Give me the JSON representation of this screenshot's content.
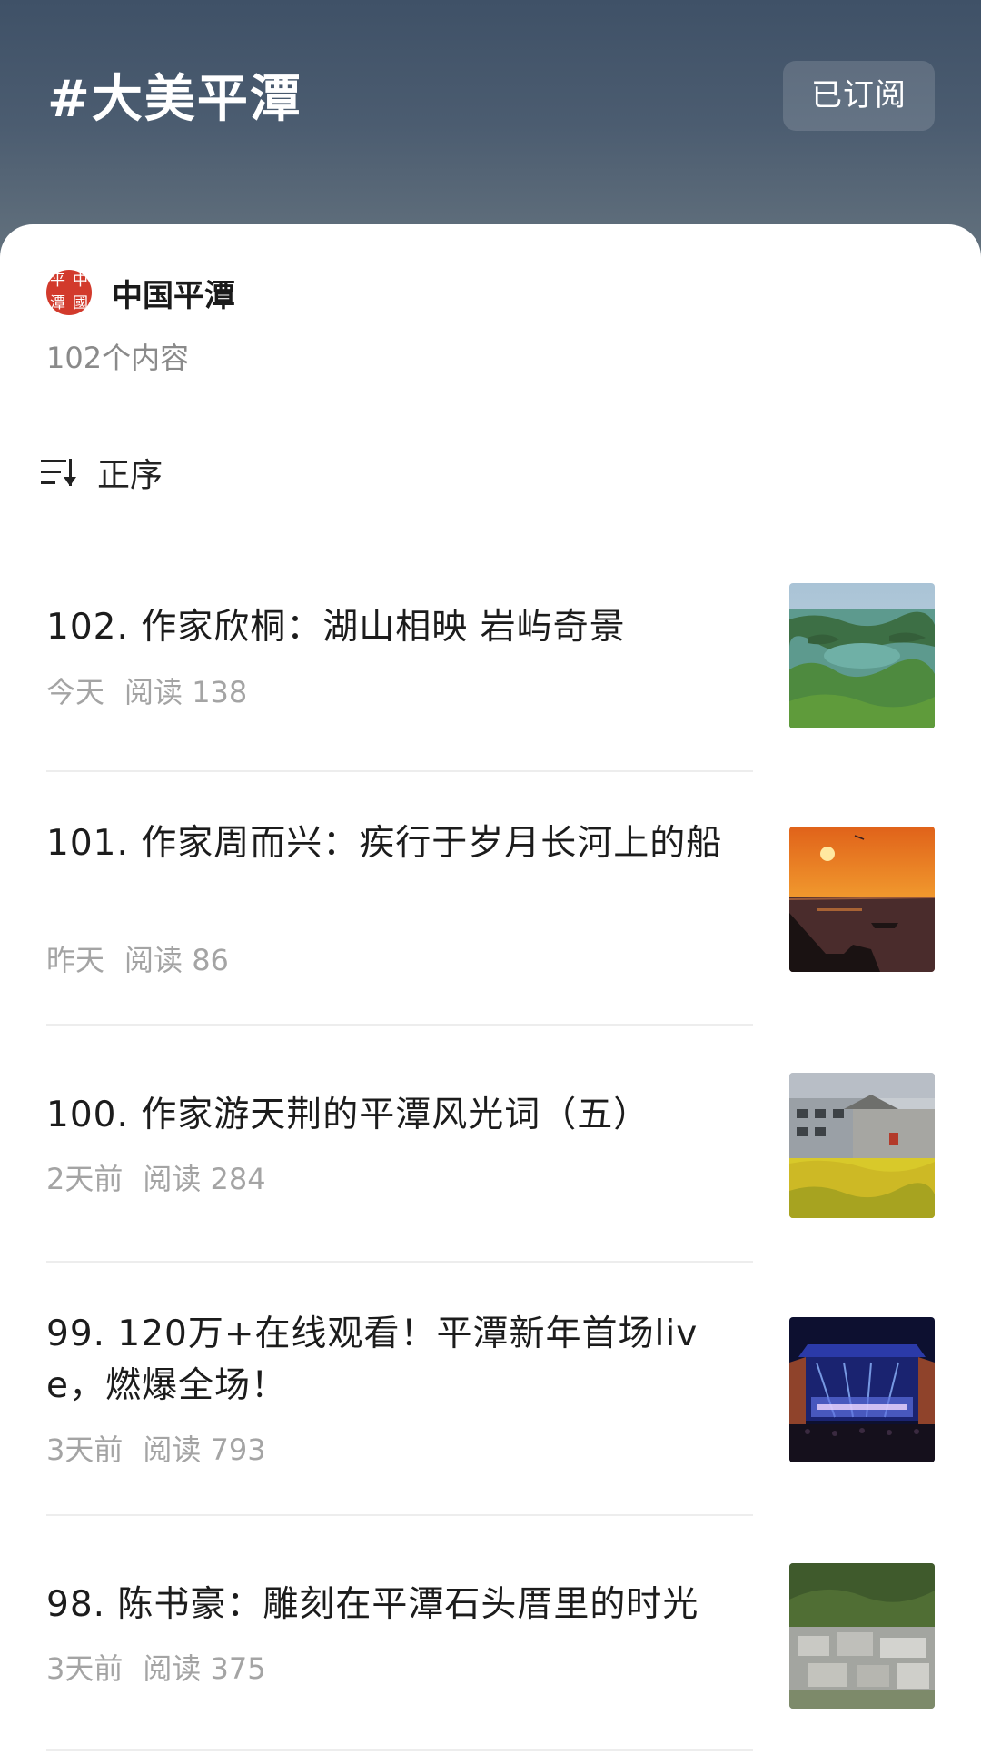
{
  "header": {
    "topic_title": "#大美平潭",
    "subscribe_label": "已订阅"
  },
  "account": {
    "avatar_text": [
      "平",
      "中",
      "潭",
      "國"
    ],
    "name": "中国平潭",
    "content_count": "102个内容"
  },
  "sort": {
    "label": "正序"
  },
  "articles": [
    {
      "title": "102. 作家欣桐：湖山相映 岩屿奇景",
      "date": "今天",
      "reads": "阅读 138",
      "thumb": "lake-islands"
    },
    {
      "title": "101. 作家周而兴：疾行于岁月长河上的船",
      "date": "昨天",
      "reads": "阅读 86",
      "thumb": "sunset-boat"
    },
    {
      "title": "100. 作家游天荆的平潭风光词（五）",
      "date": "2天前",
      "reads": "阅读 284",
      "thumb": "village-flowers"
    },
    {
      "title": "99. 120万+在线观看！平潭新年首场live，燃爆全场！",
      "date": "3天前",
      "reads": "阅读 793",
      "thumb": "concert-stage"
    },
    {
      "title": "98. 陈书豪：雕刻在平潭石头厝里的时光",
      "date": "3天前",
      "reads": "阅读 375",
      "thumb": "stone-houses"
    }
  ]
}
